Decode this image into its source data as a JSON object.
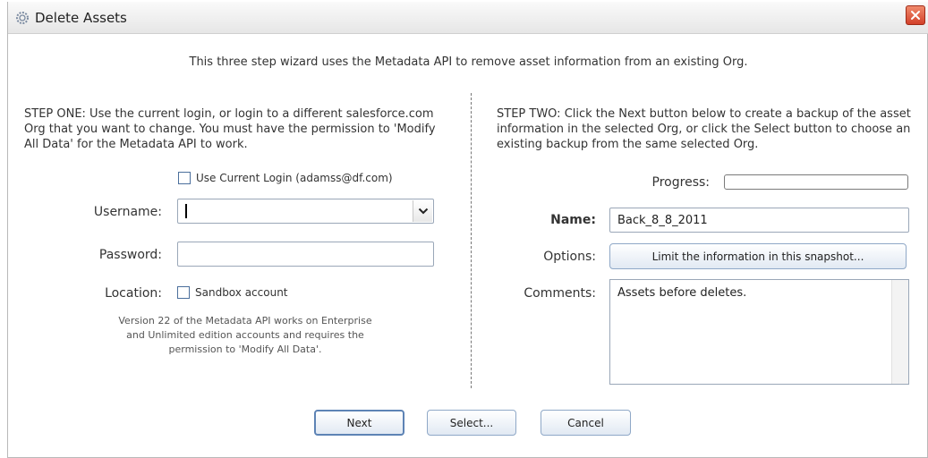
{
  "window": {
    "title": "Delete Assets",
    "icon": "gear-icon",
    "close_icon": "close-icon"
  },
  "intro": "This three step wizard uses the Metadata API to remove asset information from an existing Org.",
  "step_one": {
    "text": "STEP ONE: Use the current login, or login to a different salesforce.com Org that you want to change. You must have the permission to 'Modify All Data' for the Metadata API to work.",
    "use_current_login_label": "Use Current Login (adamss@df.com)",
    "use_current_login_checked": false,
    "username_label": "Username:",
    "username_value": "",
    "password_label": "Password:",
    "password_value": "",
    "location_label": "Location:",
    "sandbox_label": "Sandbox account",
    "sandbox_checked": false,
    "note": "Version 22 of the Metadata API works on Enterprise and Unlimited edition accounts and requires the permission to 'Modify All Data'."
  },
  "step_two": {
    "text": "STEP TWO: Click the Next button below to create a backup of the asset information in the selected Org, or click the Select button to choose an existing backup from the same selected Org.",
    "progress_label": "Progress:",
    "progress": 0,
    "name_label": "Name:",
    "name_value": "Back_8_8_2011",
    "options_label": "Options:",
    "options_button": "Limit the information in this snapshot...",
    "comments_label": "Comments:",
    "comments_value": "Assets before deletes."
  },
  "buttons": {
    "next": "Next",
    "select": "Select...",
    "cancel": "Cancel"
  },
  "colors": {
    "button_border": "#8fa8c7",
    "close_red": "#d3412a"
  }
}
